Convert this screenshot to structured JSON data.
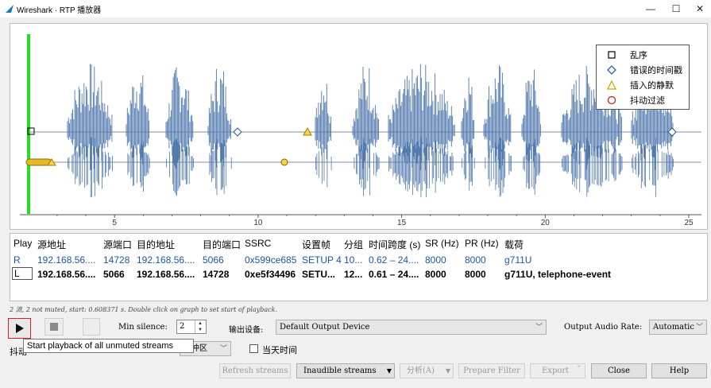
{
  "window": {
    "title": "Wireshark · RTP 播放器",
    "minimize": "—",
    "maximize": "☐",
    "close": "✕"
  },
  "graph": {
    "x_ticks": [
      "5",
      "10",
      "15",
      "20",
      "25"
    ],
    "legend": [
      {
        "symbol": "square",
        "label": "乱序",
        "color": "#000000"
      },
      {
        "symbol": "diamond",
        "label": "错误的时间戳",
        "color": "#1d56a4"
      },
      {
        "symbol": "triangle",
        "label": "插入的静默",
        "color": "#c9a400"
      },
      {
        "symbol": "circle",
        "label": "抖动过滤",
        "color": "#c01818"
      }
    ],
    "colors": {
      "wave": "#4f77ad",
      "cursor": "#22dd22",
      "axis": "#555555"
    }
  },
  "table": {
    "headers": [
      "Play",
      "源地址",
      "源端口",
      "目的地址",
      "目的端口",
      "SSRC",
      "设置帧",
      "分组",
      "时间跨度 (s)",
      "SR (Hz)",
      "PR (Hz)",
      "载荷"
    ],
    "rows": [
      [
        "R",
        "192.168.56....",
        "14728",
        "192.168.56....",
        "5066",
        "0x599ce685",
        "SETUP 4",
        "10...",
        "0.62 – 24....",
        "8000",
        "8000",
        "g711U"
      ],
      [
        "L",
        "192.168.56....",
        "5066",
        "192.168.56....",
        "14728",
        "0xe5f34496",
        "SETU...",
        "12...",
        "0.61 – 24....",
        "8000",
        "8000",
        "g711U, telephone-event"
      ]
    ]
  },
  "status": "2 流, 2 not muted, start: 0.608371 s. Double click on graph to set start of playback.",
  "controls": {
    "min_silence_label": "Min silence:",
    "min_silence_value": "2",
    "output_device_label": "输出设备:",
    "output_device_value": "Default Output Device",
    "output_rate_label": "Output Audio Rate:",
    "output_rate_value": "Automatic",
    "jitter_label": "抖动",
    "buffer_value": "缓冲区",
    "today_label": "当天时间",
    "tooltip": "Start playback of all unmuted streams"
  },
  "buttons": {
    "refresh": "Refresh streams",
    "inaudible": "Inaudible streams",
    "analyze": "分析(A)",
    "prepare": "Prepare Filter",
    "export": "Export",
    "close": "Close",
    "help": "Help"
  }
}
